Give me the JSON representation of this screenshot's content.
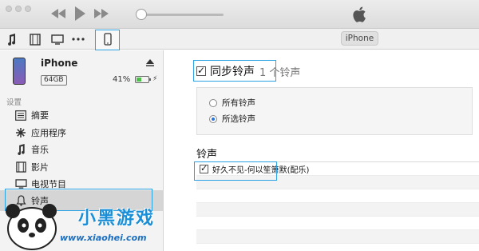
{
  "topbar": {
    "transport_icons": [
      "rewind-icon",
      "play-icon",
      "fast-forward-icon"
    ],
    "volume": 0.0,
    "logo": "apple-logo-icon"
  },
  "toolbar": {
    "media_icons": [
      "music-note-icon",
      "film-icon",
      "tv-icon",
      "more-icon"
    ],
    "device_button_icon": "iphone-icon",
    "device_pill": "iPhone"
  },
  "device": {
    "name": "iPhone",
    "capacity": "64GB",
    "battery": "41%",
    "battery_level": 0.41
  },
  "sidebar": {
    "section_label": "设置",
    "items": [
      {
        "label": "摘要",
        "icon": "summary-icon"
      },
      {
        "label": "应用程序",
        "icon": "apps-icon"
      },
      {
        "label": "音乐",
        "icon": "music-note-icon"
      },
      {
        "label": "影片",
        "icon": "film-icon"
      },
      {
        "label": "电视节目",
        "icon": "tv-icon"
      },
      {
        "label": "铃声",
        "icon": "bell-icon"
      }
    ]
  },
  "main": {
    "sync_label": "同步铃声",
    "sync_count": "1 个铃声",
    "sync_checked": true,
    "options": [
      {
        "label": "所有铃声",
        "selected": false
      },
      {
        "label": "所选铃声",
        "selected": true
      }
    ],
    "list_title": "铃声",
    "tones": [
      {
        "label": "好久不见-何以笙箫默(配乐)",
        "checked": true
      }
    ]
  },
  "watermark": {
    "text": "小黑游戏",
    "url": "www.xiaohei.com"
  },
  "colors": {
    "highlight": "#2aa2e3",
    "battery": "#4cc14a"
  }
}
